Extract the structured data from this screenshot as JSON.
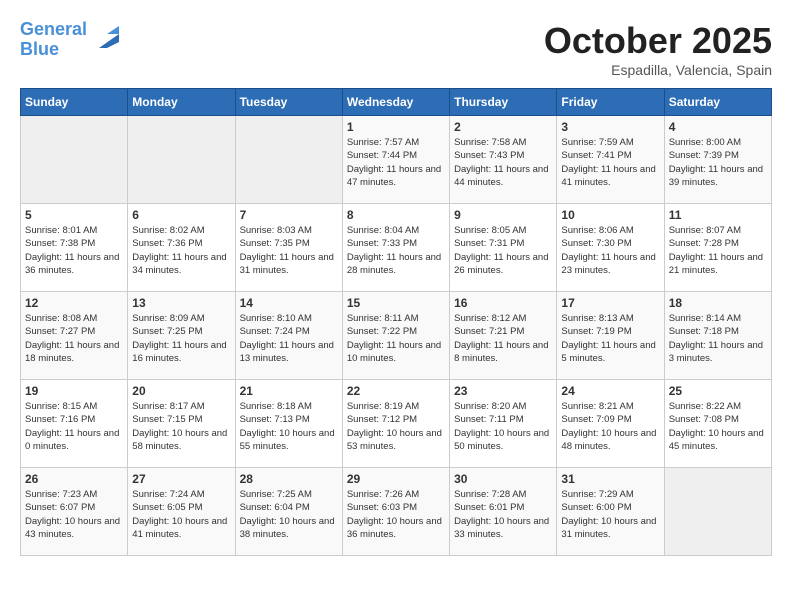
{
  "header": {
    "logo_line1": "General",
    "logo_line2": "Blue",
    "month": "October 2025",
    "location": "Espadilla, Valencia, Spain"
  },
  "days_of_week": [
    "Sunday",
    "Monday",
    "Tuesday",
    "Wednesday",
    "Thursday",
    "Friday",
    "Saturday"
  ],
  "weeks": [
    {
      "cells": [
        {
          "day": null
        },
        {
          "day": null
        },
        {
          "day": null
        },
        {
          "day": "1",
          "sunrise": "7:57 AM",
          "sunset": "7:44 PM",
          "daylight": "11 hours and 47 minutes."
        },
        {
          "day": "2",
          "sunrise": "7:58 AM",
          "sunset": "7:43 PM",
          "daylight": "11 hours and 44 minutes."
        },
        {
          "day": "3",
          "sunrise": "7:59 AM",
          "sunset": "7:41 PM",
          "daylight": "11 hours and 41 minutes."
        },
        {
          "day": "4",
          "sunrise": "8:00 AM",
          "sunset": "7:39 PM",
          "daylight": "11 hours and 39 minutes."
        }
      ]
    },
    {
      "cells": [
        {
          "day": "5",
          "sunrise": "8:01 AM",
          "sunset": "7:38 PM",
          "daylight": "11 hours and 36 minutes."
        },
        {
          "day": "6",
          "sunrise": "8:02 AM",
          "sunset": "7:36 PM",
          "daylight": "11 hours and 34 minutes."
        },
        {
          "day": "7",
          "sunrise": "8:03 AM",
          "sunset": "7:35 PM",
          "daylight": "11 hours and 31 minutes."
        },
        {
          "day": "8",
          "sunrise": "8:04 AM",
          "sunset": "7:33 PM",
          "daylight": "11 hours and 28 minutes."
        },
        {
          "day": "9",
          "sunrise": "8:05 AM",
          "sunset": "7:31 PM",
          "daylight": "11 hours and 26 minutes."
        },
        {
          "day": "10",
          "sunrise": "8:06 AM",
          "sunset": "7:30 PM",
          "daylight": "11 hours and 23 minutes."
        },
        {
          "day": "11",
          "sunrise": "8:07 AM",
          "sunset": "7:28 PM",
          "daylight": "11 hours and 21 minutes."
        }
      ]
    },
    {
      "cells": [
        {
          "day": "12",
          "sunrise": "8:08 AM",
          "sunset": "7:27 PM",
          "daylight": "11 hours and 18 minutes."
        },
        {
          "day": "13",
          "sunrise": "8:09 AM",
          "sunset": "7:25 PM",
          "daylight": "11 hours and 16 minutes."
        },
        {
          "day": "14",
          "sunrise": "8:10 AM",
          "sunset": "7:24 PM",
          "daylight": "11 hours and 13 minutes."
        },
        {
          "day": "15",
          "sunrise": "8:11 AM",
          "sunset": "7:22 PM",
          "daylight": "11 hours and 10 minutes."
        },
        {
          "day": "16",
          "sunrise": "8:12 AM",
          "sunset": "7:21 PM",
          "daylight": "11 hours and 8 minutes."
        },
        {
          "day": "17",
          "sunrise": "8:13 AM",
          "sunset": "7:19 PM",
          "daylight": "11 hours and 5 minutes."
        },
        {
          "day": "18",
          "sunrise": "8:14 AM",
          "sunset": "7:18 PM",
          "daylight": "11 hours and 3 minutes."
        }
      ]
    },
    {
      "cells": [
        {
          "day": "19",
          "sunrise": "8:15 AM",
          "sunset": "7:16 PM",
          "daylight": "11 hours and 0 minutes."
        },
        {
          "day": "20",
          "sunrise": "8:17 AM",
          "sunset": "7:15 PM",
          "daylight": "10 hours and 58 minutes."
        },
        {
          "day": "21",
          "sunrise": "8:18 AM",
          "sunset": "7:13 PM",
          "daylight": "10 hours and 55 minutes."
        },
        {
          "day": "22",
          "sunrise": "8:19 AM",
          "sunset": "7:12 PM",
          "daylight": "10 hours and 53 minutes."
        },
        {
          "day": "23",
          "sunrise": "8:20 AM",
          "sunset": "7:11 PM",
          "daylight": "10 hours and 50 minutes."
        },
        {
          "day": "24",
          "sunrise": "8:21 AM",
          "sunset": "7:09 PM",
          "daylight": "10 hours and 48 minutes."
        },
        {
          "day": "25",
          "sunrise": "8:22 AM",
          "sunset": "7:08 PM",
          "daylight": "10 hours and 45 minutes."
        }
      ]
    },
    {
      "cells": [
        {
          "day": "26",
          "sunrise": "7:23 AM",
          "sunset": "6:07 PM",
          "daylight": "10 hours and 43 minutes."
        },
        {
          "day": "27",
          "sunrise": "7:24 AM",
          "sunset": "6:05 PM",
          "daylight": "10 hours and 41 minutes."
        },
        {
          "day": "28",
          "sunrise": "7:25 AM",
          "sunset": "6:04 PM",
          "daylight": "10 hours and 38 minutes."
        },
        {
          "day": "29",
          "sunrise": "7:26 AM",
          "sunset": "6:03 PM",
          "daylight": "10 hours and 36 minutes."
        },
        {
          "day": "30",
          "sunrise": "7:28 AM",
          "sunset": "6:01 PM",
          "daylight": "10 hours and 33 minutes."
        },
        {
          "day": "31",
          "sunrise": "7:29 AM",
          "sunset": "6:00 PM",
          "daylight": "10 hours and 31 minutes."
        },
        {
          "day": null
        }
      ]
    }
  ]
}
